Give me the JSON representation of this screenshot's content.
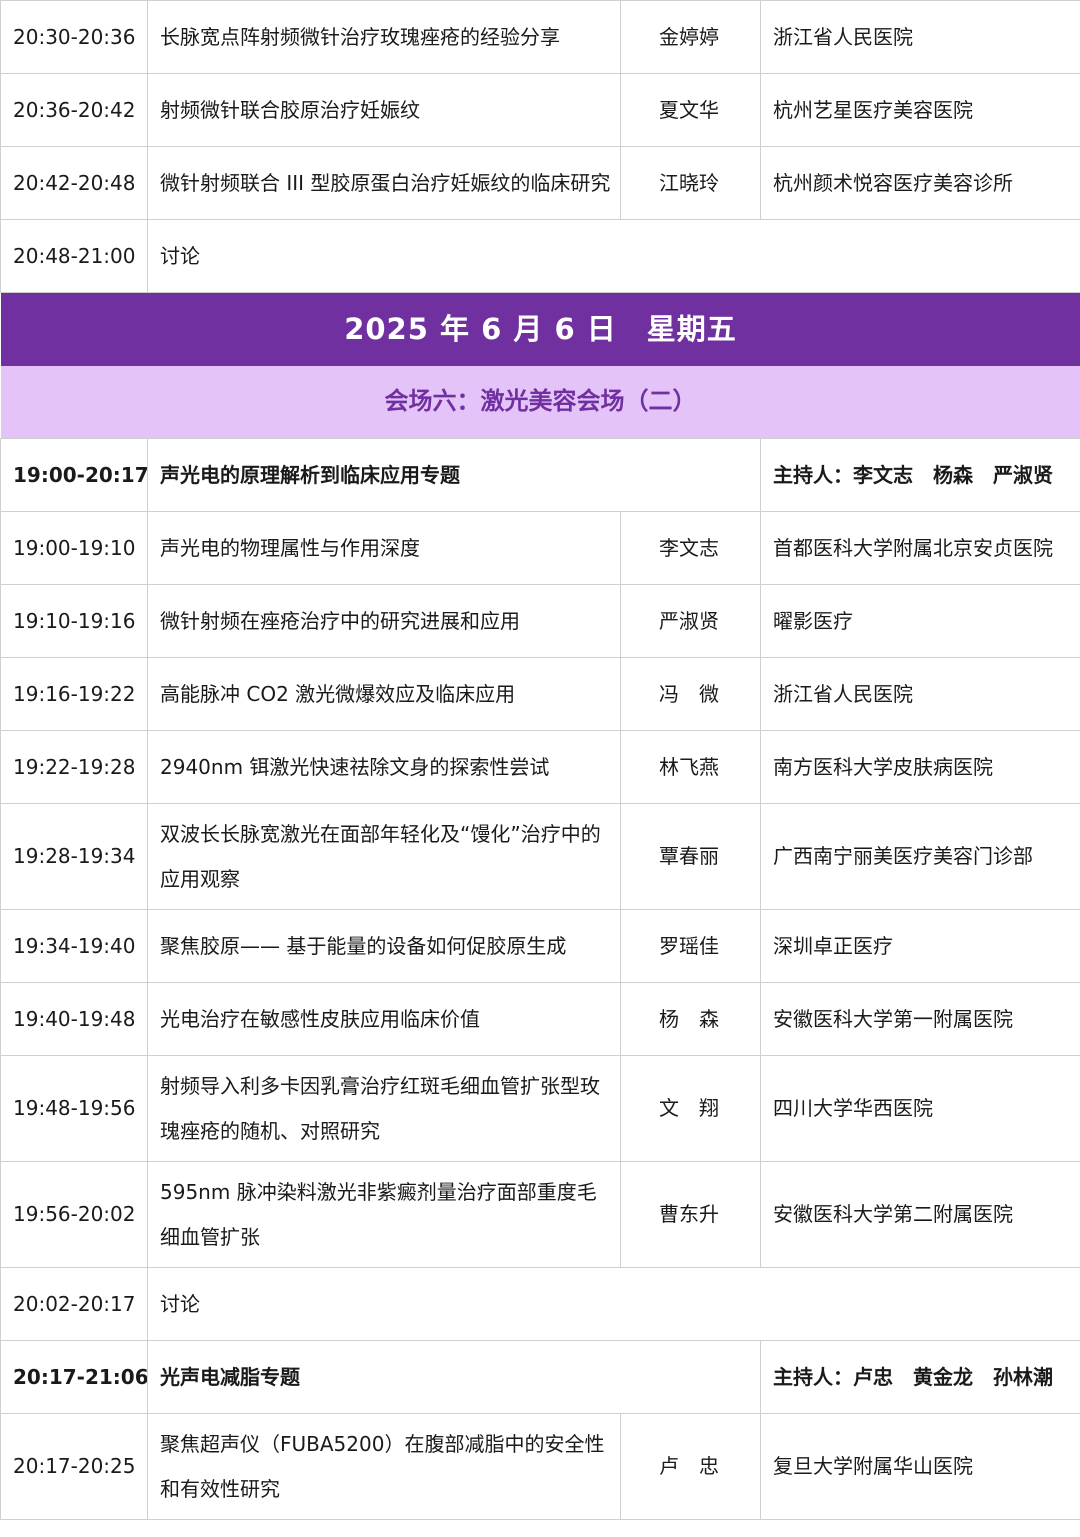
{
  "colors": {
    "date_bg": "#7030a0",
    "venue_bg": "#e4c4f8",
    "venue_text": "#7030a0",
    "border": "#cfcfcf"
  },
  "top_rows": [
    {
      "time": "20:30-20:36",
      "topic": "长脉宽点阵射频微针治疗玫瑰痤疮的经验分享",
      "speaker": "金婷婷",
      "org": "浙江省人民医院"
    },
    {
      "time": "20:36-20:42",
      "topic": "射频微针联合胶原治疗妊娠纹",
      "speaker": "夏文华",
      "org": "杭州艺星医疗美容医院"
    },
    {
      "time": "20:42-20:48",
      "topic": "微针射频联合 III 型胶原蛋白治疗妊娠纹的临床研究",
      "speaker": "江晓玲",
      "org": "杭州颜术悦容医疗美容诊所"
    },
    {
      "time": "20:48-21:00",
      "topic": "讨论"
    }
  ],
  "date_header": {
    "date": "2025 年 6 月 6 日",
    "weekday": "星期五"
  },
  "venue_header": "会场六：激光美容会场（二）",
  "session1": {
    "time": "19:00-20:17",
    "title": "声光电的原理解析到临床应用专题",
    "host_label": "主持人：",
    "hosts": [
      "李文志",
      "杨森",
      "严淑贤"
    ]
  },
  "session1_rows": [
    {
      "time": "19:00-19:10",
      "topic": "声光电的物理属性与作用深度",
      "speaker": "李文志",
      "org": "首都医科大学附属北京安贞医院"
    },
    {
      "time": "19:10-19:16",
      "topic": "微针射频在痤疮治疗中的研究进展和应用",
      "speaker": "严淑贤",
      "org": "曜影医疗"
    },
    {
      "time": "19:16-19:22",
      "topic": "高能脉冲 CO2 激光微爆效应及临床应用",
      "speaker": "冯　微",
      "org": "浙江省人民医院"
    },
    {
      "time": "19:22-19:28",
      "topic": "2940nm 铒激光快速祛除文身的探索性尝试",
      "speaker": "林飞燕",
      "org": "南方医科大学皮肤病医院"
    },
    {
      "time": "19:28-19:34",
      "topic": "双波长长脉宽激光在面部年轻化及“馒化”治疗中的应用观察",
      "speaker": "覃春丽",
      "org": "广西南宁丽美医疗美容门诊部",
      "tall": true
    },
    {
      "time": "19:34-19:40",
      "topic": "聚焦胶原—— 基于能量的设备如何促胶原生成",
      "speaker": "罗瑶佳",
      "org": "深圳卓正医疗"
    },
    {
      "time": "19:40-19:48",
      "topic": "光电治疗在敏感性皮肤应用临床价值",
      "speaker": "杨　森",
      "org": "安徽医科大学第一附属医院"
    },
    {
      "time": "19:48-19:56",
      "topic": "射频导入利多卡因乳膏治疗红斑毛细血管扩张型玫瑰痤疮的随机、对照研究",
      "speaker": "文　翔",
      "org": "四川大学华西医院",
      "tall": true
    },
    {
      "time": "19:56-20:02",
      "topic": "595nm 脉冲染料激光非紫癜剂量治疗面部重度毛细血管扩张",
      "speaker": "曹东升",
      "org": "安徽医科大学第二附属医院",
      "tall": true
    },
    {
      "time": "20:02-20:17",
      "topic": "讨论"
    }
  ],
  "session2": {
    "time": "20:17-21:06",
    "title": "光声电减脂专题",
    "host_label": "主持人：",
    "hosts": [
      "卢忠",
      "黄金龙",
      "孙林潮"
    ]
  },
  "session2_rows": [
    {
      "time": "20:17-20:25",
      "topic": "聚焦超声仪（FUBA5200）在腹部减脂中的安全性和有效性研究",
      "speaker": "卢　忠",
      "org": "复旦大学附属华山医院",
      "tall": true
    }
  ]
}
